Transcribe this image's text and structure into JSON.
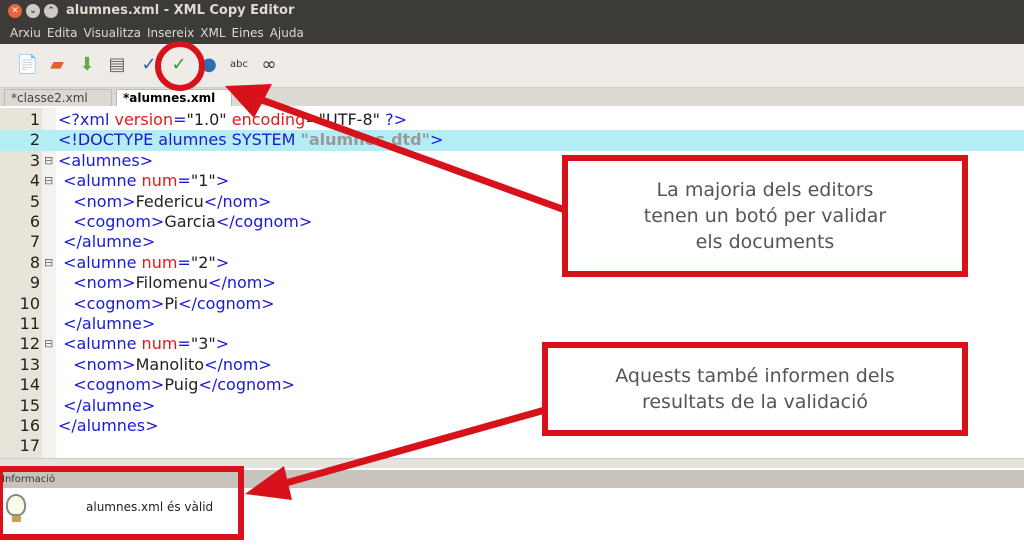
{
  "window": {
    "title": "alumnes.xml - XML Copy Editor"
  },
  "menu": [
    "Arxiu",
    "Edita",
    "Visualitza",
    "Insereix",
    "XML",
    "Eines",
    "Ajuda"
  ],
  "toolbar": [
    {
      "icon": "new-document-icon"
    },
    {
      "icon": "open-folder-icon"
    },
    {
      "icon": "save-icon"
    },
    {
      "icon": "print-icon"
    },
    {
      "icon": "check-well-formed-icon"
    },
    {
      "icon": "validate-icon"
    },
    {
      "icon": "browser-globe-icon"
    },
    {
      "icon": "spellcheck-icon"
    },
    {
      "icon": "link-icon"
    }
  ],
  "tabs": [
    {
      "label": "*classe2.xml",
      "active": false
    },
    {
      "label": "*alumnes.xml",
      "active": true
    }
  ],
  "editor": {
    "highlighted_line": 2,
    "lines": [
      [
        [
          "tag",
          "<?xml "
        ],
        [
          "att",
          "version"
        ],
        [
          "tag",
          "="
        ],
        [
          "val",
          "\"1.0\" "
        ],
        [
          "att",
          "encoding"
        ],
        [
          "tag",
          "="
        ],
        [
          "val",
          "\"UTF-8\""
        ],
        [
          "tag",
          " ?>"
        ]
      ],
      [
        [
          "tag",
          "<!DOCTYPE alumnes SYSTEM "
        ],
        [
          "dtd",
          "\"alumnes.dtd\""
        ],
        [
          "tag",
          ">"
        ]
      ],
      [
        [
          "tag",
          "<alumnes>"
        ]
      ],
      [
        [
          "tag",
          " <alumne "
        ],
        [
          "att",
          "num"
        ],
        [
          "tag",
          "="
        ],
        [
          "val",
          "\"1\""
        ],
        [
          "tag",
          ">"
        ]
      ],
      [
        [
          "tag",
          "   <nom>"
        ],
        [
          "txt",
          "Federicu"
        ],
        [
          "tag",
          "</nom>"
        ]
      ],
      [
        [
          "tag",
          "   <cognom>"
        ],
        [
          "txt",
          "Garcia"
        ],
        [
          "tag",
          "</cognom>"
        ]
      ],
      [
        [
          "tag",
          " </alumne>"
        ]
      ],
      [
        [
          "tag",
          " <alumne "
        ],
        [
          "att",
          "num"
        ],
        [
          "tag",
          "="
        ],
        [
          "val",
          "\"2\""
        ],
        [
          "tag",
          ">"
        ]
      ],
      [
        [
          "tag",
          "   <nom>"
        ],
        [
          "txt",
          "Filomenu"
        ],
        [
          "tag",
          "</nom>"
        ]
      ],
      [
        [
          "tag",
          "   <cognom>"
        ],
        [
          "txt",
          "Pi"
        ],
        [
          "tag",
          "</cognom>"
        ]
      ],
      [
        [
          "tag",
          " </alumne>"
        ]
      ],
      [
        [
          "tag",
          " <alumne "
        ],
        [
          "att",
          "num"
        ],
        [
          "tag",
          "="
        ],
        [
          "val",
          "\"3\""
        ],
        [
          "tag",
          ">"
        ]
      ],
      [
        [
          "tag",
          "   <nom>"
        ],
        [
          "txt",
          "Manolito"
        ],
        [
          "tag",
          "</nom>"
        ]
      ],
      [
        [
          "tag",
          "   <cognom>"
        ],
        [
          "txt",
          "Puig"
        ],
        [
          "tag",
          "</cognom>"
        ]
      ],
      [
        [
          "tag",
          " </alumne>"
        ]
      ],
      [
        [
          "tag",
          "</alumnes>"
        ]
      ],
      []
    ],
    "fold_markers": {
      "3": "⊟",
      "4": "⊟",
      "8": "⊟",
      "12": "⊟"
    }
  },
  "info_panel": {
    "title": "Informació",
    "icon": "lightbulb-icon",
    "message": "alumnes.xml és vàlid"
  },
  "callouts": [
    {
      "text": "La majoria dels editors tenen un botó per validar els documents"
    },
    {
      "text": "Aquests també informen dels resultats de la validació"
    }
  ],
  "annotation_color": "#d8121b"
}
